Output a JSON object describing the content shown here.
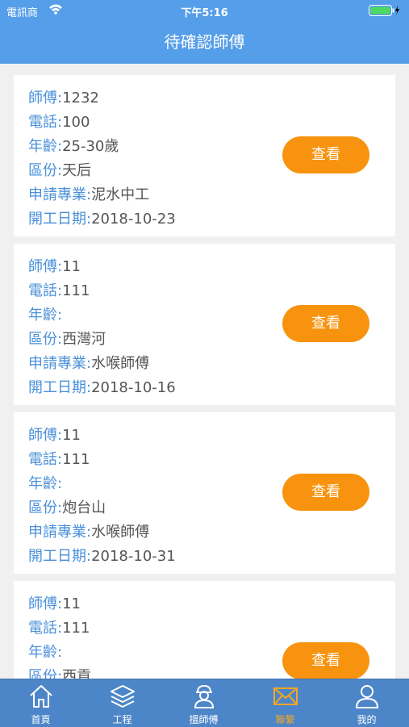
{
  "status_bar": {
    "carrier": "電訊商",
    "time": "下午5:16"
  },
  "header": {
    "title": "待確認師傅"
  },
  "labels": {
    "master": "師傅",
    "phone": "電話",
    "age": "年齡",
    "district": "區份",
    "specialty": "申請專業",
    "start_date": "開工日期",
    "colon": ":"
  },
  "cards": [
    {
      "master": "1232",
      "phone": "100",
      "age": "25-30歲",
      "district": "天后",
      "specialty": "泥水中工",
      "start_date": "2018-10-23",
      "button": "查看"
    },
    {
      "master": "11",
      "phone": "111",
      "age": "",
      "district": "西灣河",
      "specialty": "水喉師傅",
      "start_date": "2018-10-16",
      "button": "查看"
    },
    {
      "master": "11",
      "phone": "111",
      "age": "",
      "district": "炮台山",
      "specialty": "水喉師傅",
      "start_date": "2018-10-31",
      "button": "查看"
    },
    {
      "master": "11",
      "phone": "111",
      "age": "",
      "district": "西貢",
      "button": "查看"
    }
  ],
  "tabbar": {
    "items": [
      {
        "label": "首頁",
        "icon": "home-icon"
      },
      {
        "label": "工程",
        "icon": "layers-icon"
      },
      {
        "label": "搵師傅",
        "icon": "worker-icon"
      },
      {
        "label": "聯繫",
        "icon": "mail-icon",
        "active": true
      },
      {
        "label": "我的",
        "icon": "user-icon"
      }
    ],
    "active_color": "#f5a623"
  },
  "colors": {
    "header": "#559ee9",
    "tabbar": "#4d86c8",
    "button": "#f7930e",
    "label": "#4a90d9"
  }
}
